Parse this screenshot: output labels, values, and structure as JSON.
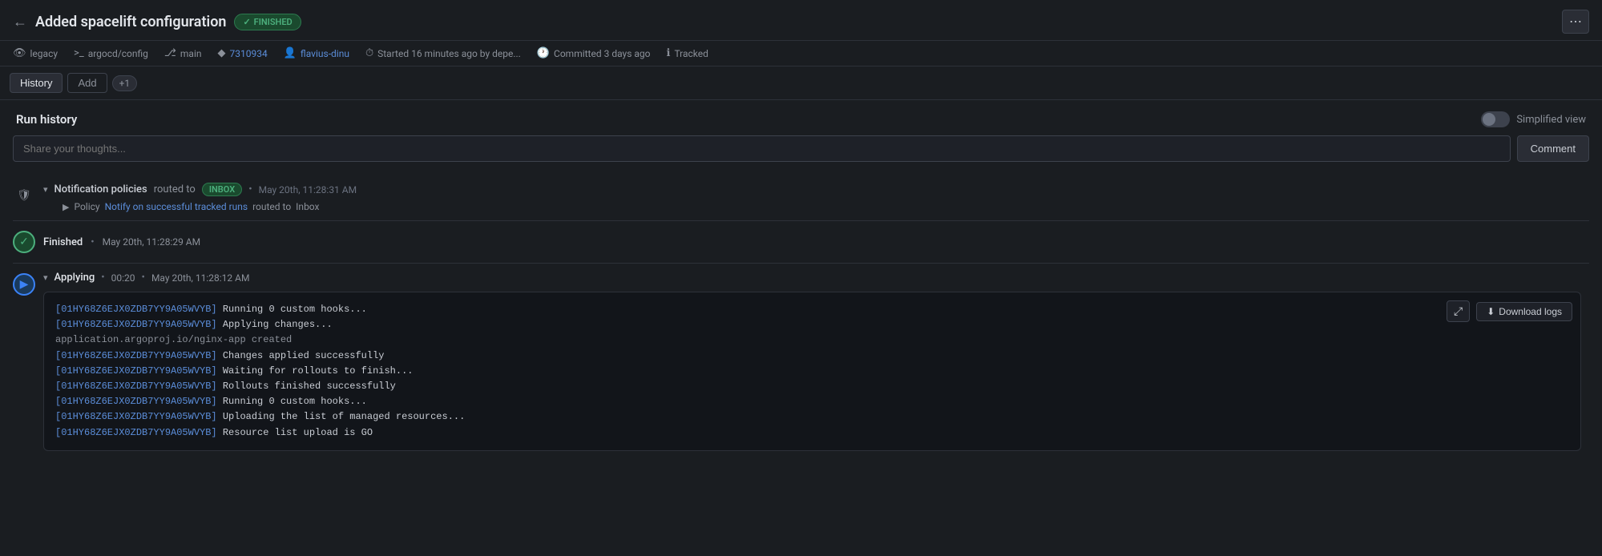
{
  "header": {
    "back_icon": "←",
    "title": "Added spacelift configuration",
    "status": "FINISHED",
    "status_check": "✓",
    "more_icon": "⋯"
  },
  "meta": [
    {
      "icon": "👁",
      "text": "legacy",
      "type": "label"
    },
    {
      "icon": ">_",
      "text": "argocd/config",
      "type": "label"
    },
    {
      "icon": "⎇",
      "text": "main",
      "type": "label"
    },
    {
      "icon": "◆",
      "text": "7310934",
      "type": "link"
    },
    {
      "icon": "👤",
      "text": "flavius-dinu",
      "type": "link"
    },
    {
      "icon": "⏱",
      "text": "Started 16 minutes ago by depe...",
      "type": "label"
    },
    {
      "icon": "🕐",
      "text": "Committed 3 days ago",
      "type": "label"
    },
    {
      "icon": "ℹ",
      "text": "Tracked",
      "type": "label"
    }
  ],
  "tabs": {
    "active": "History",
    "items": [
      "History",
      "Add"
    ],
    "count": "+1"
  },
  "run_history": {
    "title": "Run history",
    "simplified_view_label": "Simplified view"
  },
  "comment": {
    "placeholder": "Share your thoughts...",
    "button_label": "Comment"
  },
  "timeline": {
    "notification": {
      "title": "Notification policies",
      "routed_to": "routed to",
      "badge": "INBOX",
      "bullet": "•",
      "time": "May 20th, 11:28:31 AM",
      "policy_label": "Policy",
      "policy_link": "Notify on successful tracked runs",
      "policy_routed": "routed to",
      "policy_dest": "Inbox"
    },
    "finished": {
      "label": "Finished",
      "bullet": "•",
      "time": "May 20th, 11:28:29 AM",
      "check": "✓"
    },
    "applying": {
      "label": "Applying",
      "bullet": "•",
      "duration": "00:20",
      "time_bullet": "•",
      "time": "May 20th, 11:28:12 AM",
      "play_icon": "▶",
      "logs": [
        {
          "id": "[01HY68Z6EJX0ZDB7YY9A05WVYB]",
          "text": " Running 0 custom hooks..."
        },
        {
          "id": "[01HY68Z6EJX0ZDB7YY9A05WVYB]",
          "text": " Applying changes..."
        },
        {
          "id": "",
          "text": "application.argoproj.io/nginx-app created",
          "plain": true
        },
        {
          "id": "[01HY68Z6EJX0ZDB7YY9A05WVYB]",
          "text": " Changes applied successfully"
        },
        {
          "id": "[01HY68Z6EJX0ZDB7YY9A05WVYB]",
          "text": " Waiting for rollouts to finish..."
        },
        {
          "id": "[01HY68Z6EJX0ZDB7YY9A05WVYB]",
          "text": " Rollouts finished successfully"
        },
        {
          "id": "[01HY68Z6EJX0ZDB7YY9A05WVYB]",
          "text": " Running 0 custom hooks..."
        },
        {
          "id": "[01HY68Z6EJX0ZDB7YY9A05WVYB]",
          "text": " Uploading the list of managed resources..."
        },
        {
          "id": "[01HY68Z6EJX0ZDB7YY9A05WVYB]",
          "text": " Resource list upload is GO"
        }
      ],
      "download_label": "Download logs",
      "download_icon": "⬇",
      "expand_icon": "⤢"
    }
  },
  "colors": {
    "accent_blue": "#5b8dd9",
    "accent_green": "#4caf7d",
    "badge_green_bg": "#1a4a2e",
    "badge_green_border": "#2d7a4f",
    "bg_dark": "#1a1d21",
    "bg_card": "#12151a",
    "border": "#2d3139"
  }
}
